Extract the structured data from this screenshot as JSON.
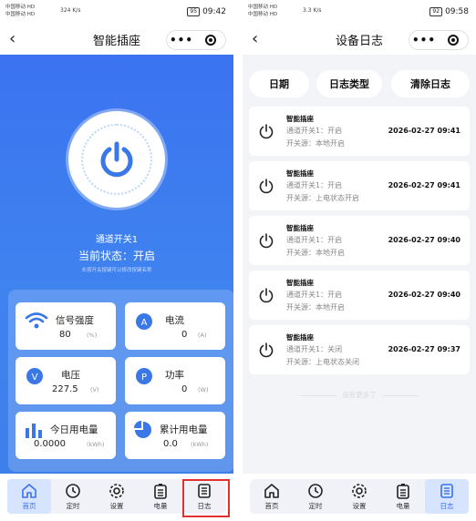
{
  "status_left": {
    "line1": "中国移动 HD",
    "line2": "中国移动 HD"
  },
  "left": {
    "status": {
      "speed": "324 K/s",
      "battery": "95",
      "time": "09:42"
    },
    "title": "智能插座",
    "more": "•••",
    "channel_name": "通道开关1",
    "state_text": "当前状态：开启",
    "tip": "长按开关按键可以修改按键名称",
    "cards": [
      {
        "label": "信号强度",
        "value": "80",
        "unit": "(%)",
        "icon": "wifi-icon"
      },
      {
        "label": "电流",
        "value": "0",
        "unit": "(A)",
        "icon": "current-icon"
      },
      {
        "label": "电压",
        "value": "227.5",
        "unit": "(V)",
        "icon": "voltage-icon"
      },
      {
        "label": "功率",
        "value": "0",
        "unit": "(W)",
        "icon": "power-meter-icon"
      },
      {
        "label": "今日用电量",
        "value": "0.0000",
        "unit": "(kWh)",
        "icon": "bar-chart-icon"
      },
      {
        "label": "累计用电量",
        "value": "0.0",
        "unit": "(kWh)",
        "icon": "pie-chart-icon"
      }
    ],
    "nav": [
      "首页",
      "定时",
      "设置",
      "电量",
      "日志"
    ]
  },
  "right": {
    "status": {
      "speed": "3.3 K/s",
      "battery": "92",
      "time": "09:58"
    },
    "title": "设备日志",
    "more": "•••",
    "tabs": [
      "日期",
      "日志类型",
      "清除日志"
    ],
    "logs": [
      {
        "device": "智能插座",
        "line1": "通道开关1：开启",
        "line2": "开关源：本地开启",
        "time": "2026-02-27 09:41"
      },
      {
        "device": "智能插座",
        "line1": "通道开关1：开启",
        "line2": "开关源：上电状态开启",
        "time": "2026-02-27 09:41"
      },
      {
        "device": "智能插座",
        "line1": "通道开关1：开启",
        "line2": "开关源：本地开启",
        "time": "2026-02-27 09:40"
      },
      {
        "device": "智能插座",
        "line1": "通道开关1：开启",
        "line2": "开关源：本地开启",
        "time": "2026-02-27 09:40"
      },
      {
        "device": "智能插座",
        "line1": "通道开关1：关闭",
        "line2": "开关源：上电状态关闭",
        "time": "2026-02-27 09:37"
      }
    ],
    "no_more": "没有更多了",
    "nav": [
      "首页",
      "定时",
      "设置",
      "电量",
      "日志"
    ]
  },
  "colors": {
    "primary": "#3a6ff0",
    "highlight": "#e03030"
  }
}
